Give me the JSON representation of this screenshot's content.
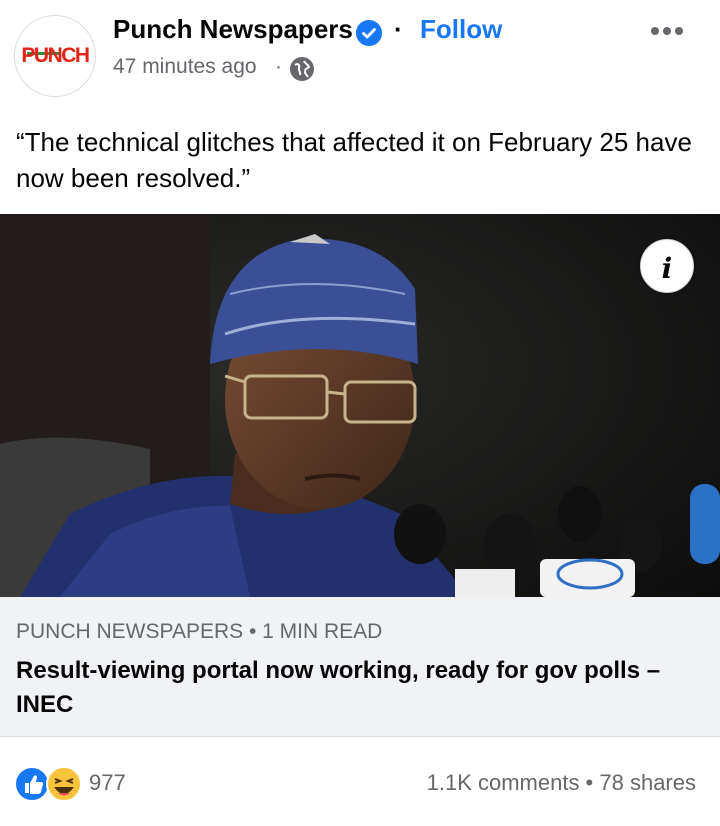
{
  "post": {
    "page_name": "Punch Newspapers",
    "follow_label": "Follow",
    "separator": "·",
    "timestamp": "47 minutes ago",
    "timestamp_separator": "·",
    "avatar_text": "PUNCH",
    "text": "“The technical glitches that affected it on February 25 have now been resolved.”"
  },
  "link_preview": {
    "source": "PUNCH NEWSPAPERS • 1 MIN READ",
    "title": "Result-viewing portal now working, ready for gov polls – INEC",
    "info_icon_glyph": "i"
  },
  "footer": {
    "reaction_count": "977",
    "reactions": [
      "like-icon",
      "haha-icon"
    ],
    "engagement": "1.1K comments • 78 shares"
  },
  "colors": {
    "accent": "#1877f2",
    "text": "#050505",
    "secondary_text": "#65676b",
    "link_box_bg": "#f0f2f5",
    "punch_red": "#e2231a"
  }
}
